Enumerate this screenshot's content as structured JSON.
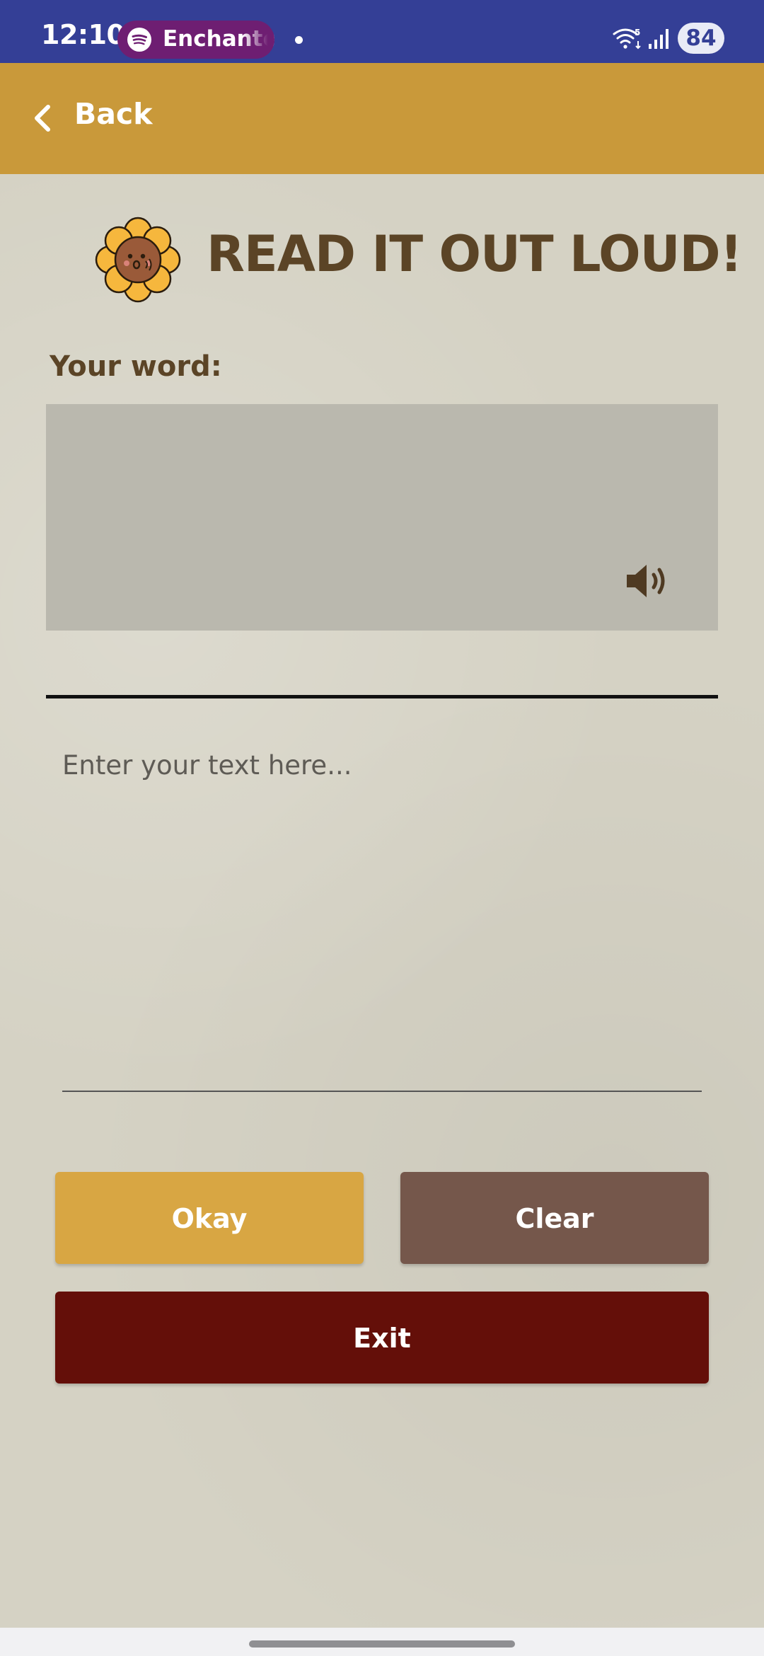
{
  "status_bar": {
    "time": "12:10",
    "media_app_icon": "spotify-icon",
    "media_title": "Enchanted",
    "wifi_icon": "wifi-icon",
    "signal_icon": "signal-icon",
    "battery": "84",
    "colors": {
      "background": "#343f96",
      "pill": "#6e1e72"
    }
  },
  "app_bar": {
    "back_icon": "chevron-left-icon",
    "back_label": "Back",
    "color": "#c9993a"
  },
  "header": {
    "icon": "sunflower-icon",
    "title": "READ IT OUT LOUD!"
  },
  "word_section": {
    "label": "Your word:",
    "word": "",
    "speaker_icon": "speaker-icon"
  },
  "answer": {
    "value": "",
    "placeholder": "Enter your text here..."
  },
  "buttons": {
    "okay": "Okay",
    "clear": "Clear",
    "exit": "Exit",
    "colors": {
      "okay": "#d8a643",
      "clear": "#75574b",
      "exit": "#640f09"
    }
  }
}
